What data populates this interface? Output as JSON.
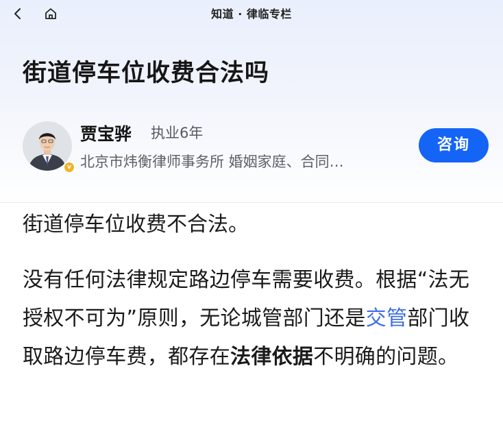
{
  "navbar": {
    "title": "知道 · 律临专栏",
    "back_icon": "chevron-left-icon",
    "home_icon": "home-icon"
  },
  "article": {
    "title": "街道停车位收费合法吗"
  },
  "author": {
    "name": "贾宝骅",
    "years": "执业6年",
    "org": "北京市炜衡律师事务所 婚姻家庭、合同…",
    "badge": "v",
    "consult_label": "咨询"
  },
  "body": {
    "para1": "街道停车位收费不合法。",
    "para2_part1": "没有任何法律规定路边停车需要收费。根据“法无授权不可为”原则，无论城管部门还是",
    "para2_link": "交管",
    "para2_part2": "部门收取路边停车费，都存在",
    "para2_bold": "法律依据",
    "para2_part3": "不明确的问题。"
  },
  "colors": {
    "accent": "#1464f6",
    "link": "#3d6fe0",
    "badge": "#f0b429"
  }
}
